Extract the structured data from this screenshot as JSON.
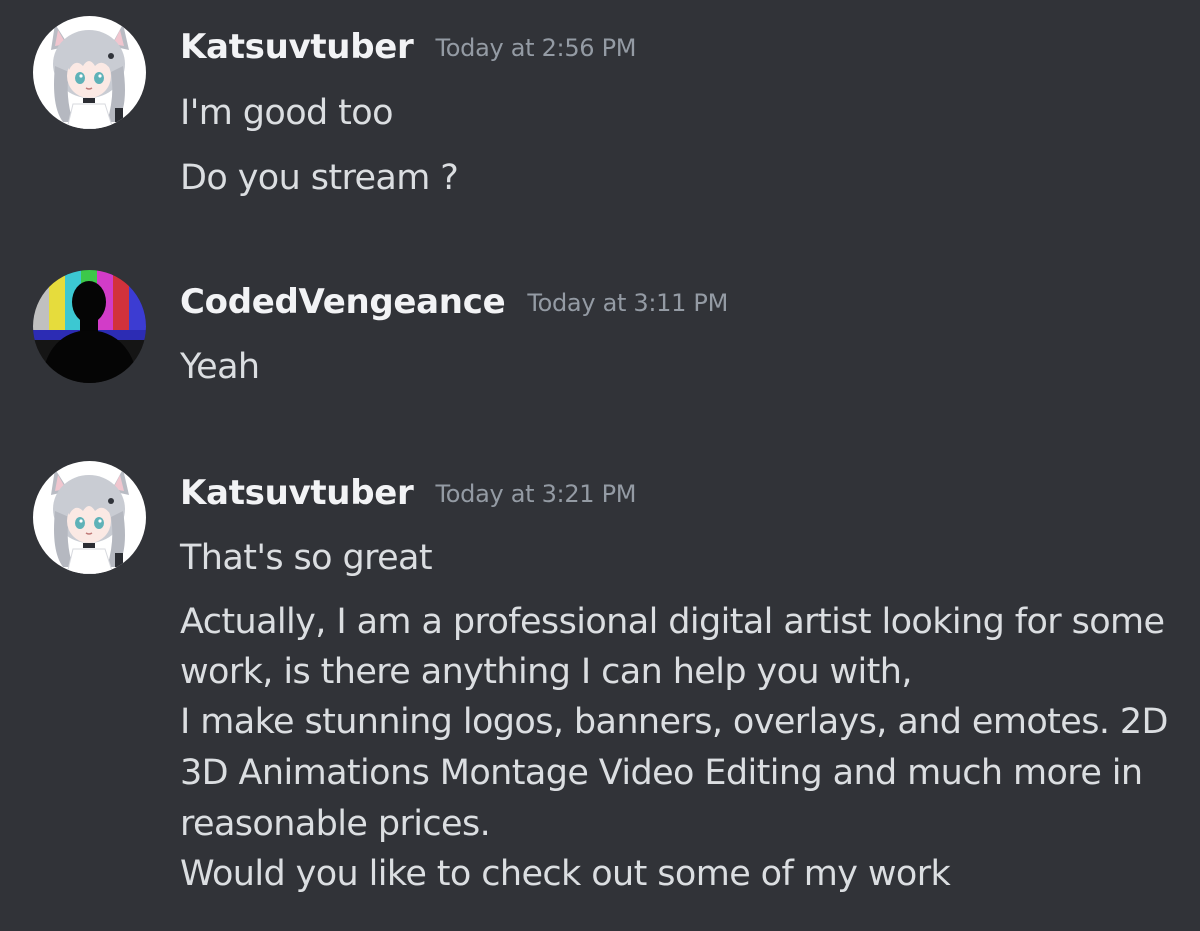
{
  "messages": [
    {
      "username": "Katsuvtuber",
      "timestamp": "Today at 2:56 PM",
      "avatar_icon": "anime-catgirl-avatar",
      "lines": [
        "I'm good too",
        "Do you stream ?"
      ]
    },
    {
      "username": "CodedVengeance",
      "timestamp": "Today at 3:11 PM",
      "avatar_icon": "silhouette-color-bars-avatar",
      "lines": [
        "Yeah"
      ]
    },
    {
      "username": "Katsuvtuber",
      "timestamp": "Today at 3:21 PM",
      "avatar_icon": "anime-catgirl-avatar",
      "lines": [
        "That's so great",
        "Actually, I am a professional digital artist looking for some",
        "work, is there anything I can help you with,",
        "I make stunning logos, banners, overlays, and emotes. 2D",
        "3D Animations Montage Video Editing and much more in",
        "reasonable prices.",
        "Would you like to check out some of my work"
      ]
    }
  ],
  "colors": {
    "background": "#313338",
    "username": "#f2f3f5",
    "timestamp": "#949ba4",
    "text": "#dbdee1"
  }
}
